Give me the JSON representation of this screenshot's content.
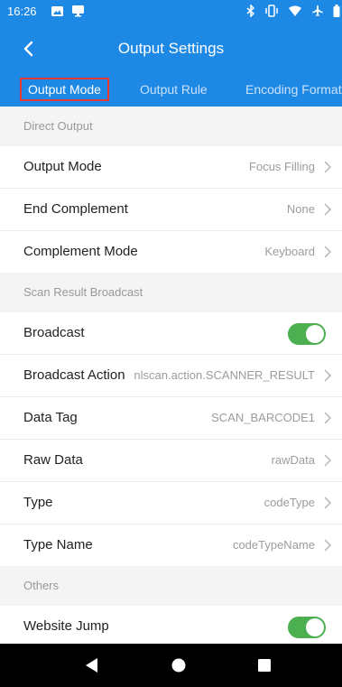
{
  "status_bar": {
    "time": "16:26",
    "icons": [
      "image-icon",
      "device-icon",
      "bluetooth-icon",
      "vibrate-icon",
      "wifi-icon",
      "airplane-icon",
      "battery-icon"
    ]
  },
  "app_bar": {
    "title": "Output Settings",
    "back_icon": "back-arrow-icon"
  },
  "tabs": [
    {
      "label": "Output Mode",
      "active": true
    },
    {
      "label": "Output Rule",
      "active": false
    },
    {
      "label": "Encoding Format",
      "active": false
    }
  ],
  "sections": {
    "direct_output": {
      "header": "Direct Output",
      "rows": [
        {
          "label": "Output Mode",
          "value": "Focus Filling"
        },
        {
          "label": "End Complement",
          "value": "None"
        },
        {
          "label": "Complement Mode",
          "value": "Keyboard"
        }
      ]
    },
    "broadcast": {
      "header": "Scan Result Broadcast",
      "toggle": {
        "label": "Broadcast",
        "enabled": true
      },
      "rows": [
        {
          "label": "Broadcast Action",
          "value": "nlscan.action.SCANNER_RESULT"
        },
        {
          "label": "Data Tag",
          "value": "SCAN_BARCODE1"
        },
        {
          "label": "Raw Data",
          "value": "rawData"
        },
        {
          "label": "Type",
          "value": "codeType"
        },
        {
          "label": "Type Name",
          "value": "codeTypeName"
        }
      ]
    },
    "others": {
      "header": "Others",
      "toggle": {
        "label": "Website Jump",
        "enabled": true
      }
    }
  },
  "navigation": {
    "icons": [
      "back-triangle-icon",
      "home-circle-icon",
      "recents-square-icon"
    ]
  },
  "colors": {
    "primary": "#1e88e5",
    "accent_toggle": "#4caf50",
    "highlight_border": "#e53935"
  }
}
